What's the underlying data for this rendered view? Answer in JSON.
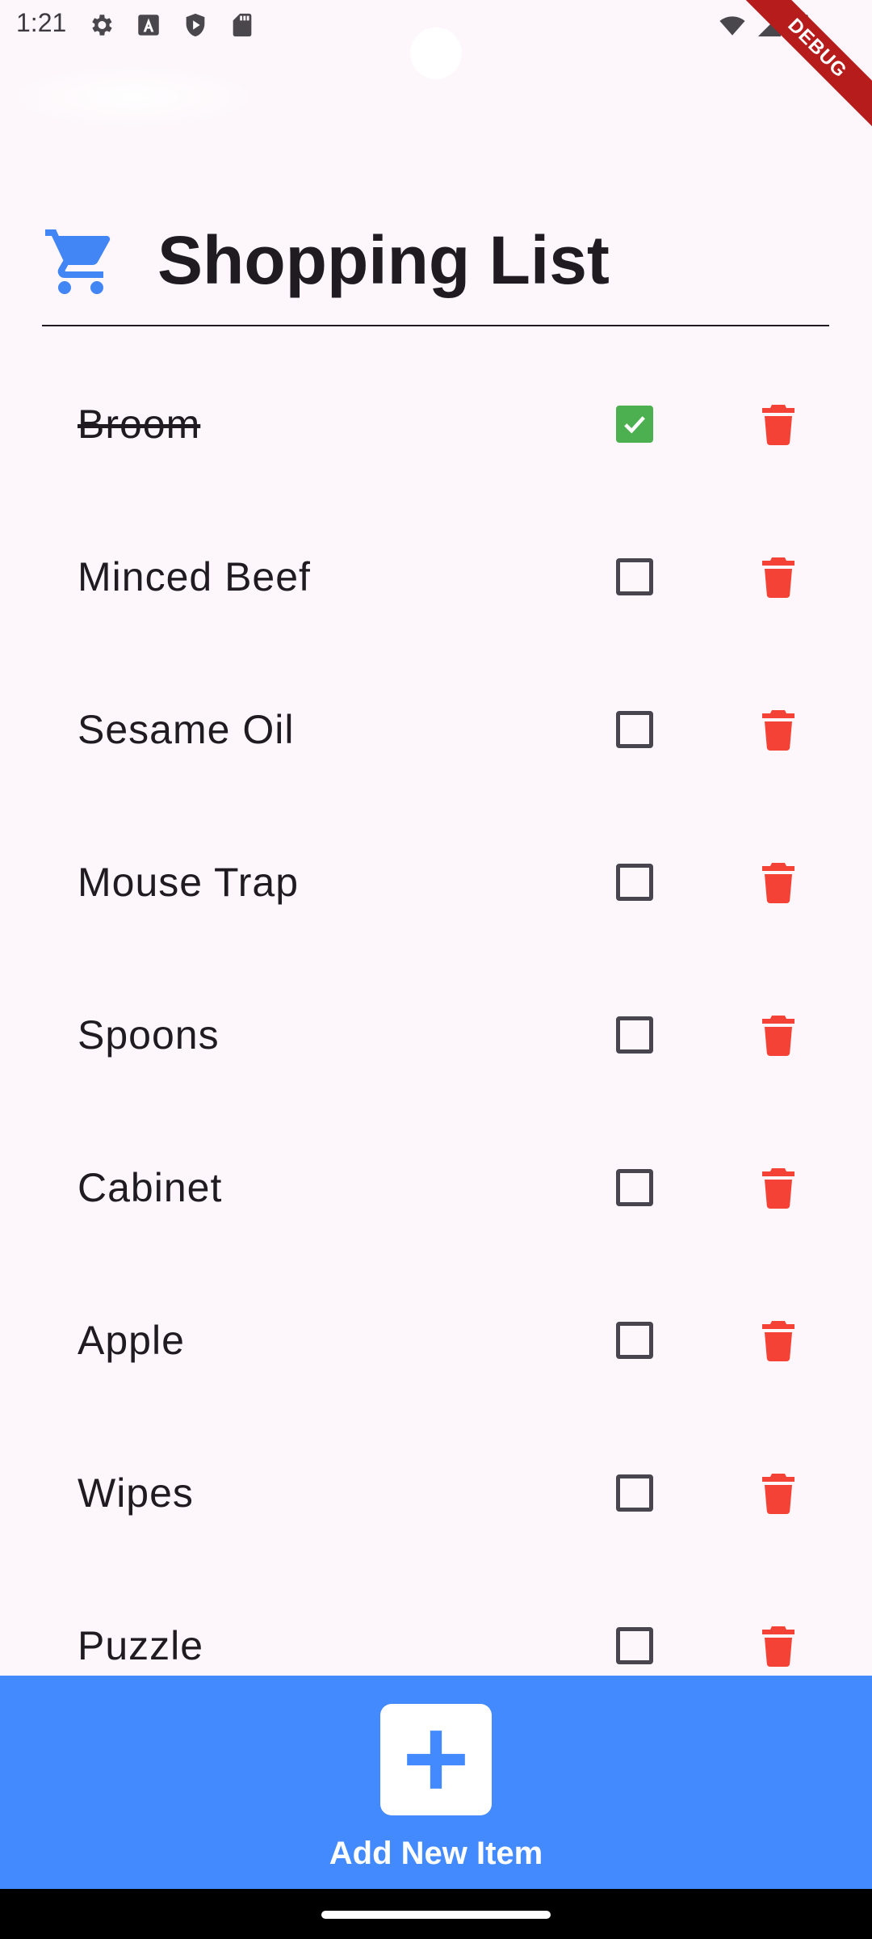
{
  "status_bar": {
    "time": "1:21",
    "debug_label": "DEBUG"
  },
  "header": {
    "title": "Shopping List",
    "icon": "shopping-cart-icon"
  },
  "items": [
    {
      "label": "Broom",
      "checked": true
    },
    {
      "label": "Minced Beef",
      "checked": false
    },
    {
      "label": "Sesame Oil",
      "checked": false
    },
    {
      "label": "Mouse Trap",
      "checked": false
    },
    {
      "label": "Spoons",
      "checked": false
    },
    {
      "label": "Cabinet",
      "checked": false
    },
    {
      "label": "Apple",
      "checked": false
    },
    {
      "label": "Wipes",
      "checked": false
    },
    {
      "label": "Puzzle",
      "checked": false
    }
  ],
  "add_bar": {
    "label": "Add New Item"
  },
  "colors": {
    "accent": "#448aff",
    "cart_icon": "#4285f4",
    "delete": "#f44336",
    "checked": "#4caf50",
    "background": "#fdf7fb"
  }
}
